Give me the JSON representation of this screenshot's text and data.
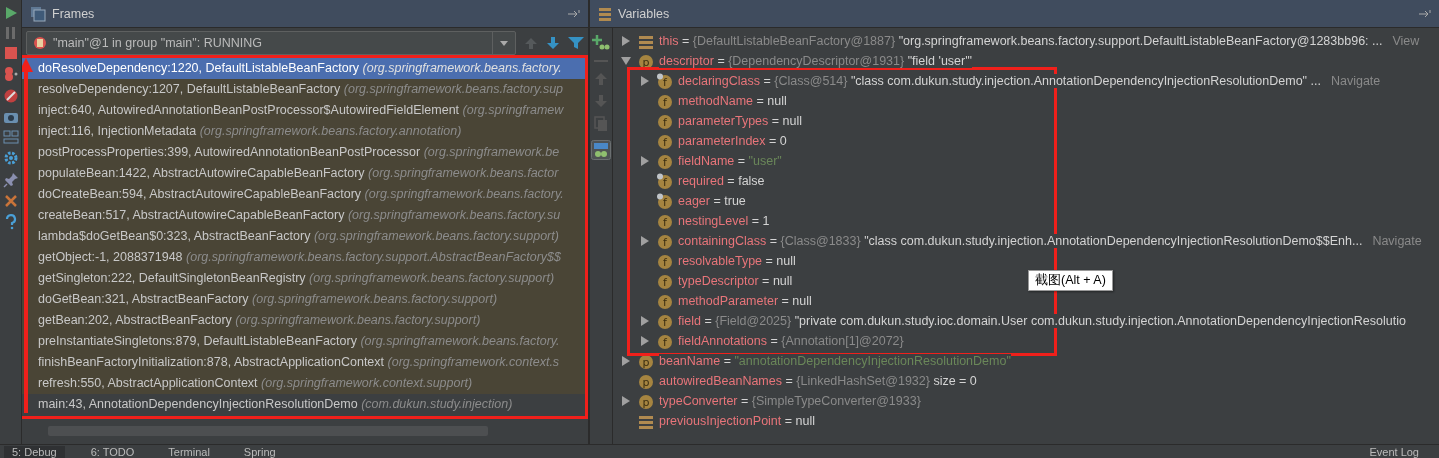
{
  "frames_panel": {
    "title": "Frames",
    "thread": "\"main\"@1 in group \"main\": RUNNING",
    "frames": [
      {
        "location": "doResolveDependency:1220, DefaultListableBeanFactory",
        "package": "(org.springframework.beans.factory.",
        "selected": true,
        "library": true
      },
      {
        "location": "resolveDependency:1207, DefaultListableBeanFactory",
        "package": "(org.springframework.beans.factory.sup",
        "selected": false,
        "library": true
      },
      {
        "location": "inject:640, AutowiredAnnotationBeanPostProcessor$AutowiredFieldElement",
        "package": "(org.springframew",
        "selected": false,
        "library": true
      },
      {
        "location": "inject:116, InjectionMetadata",
        "package": "(org.springframework.beans.factory.annotation)",
        "selected": false,
        "library": true
      },
      {
        "location": "postProcessProperties:399, AutowiredAnnotationBeanPostProcessor",
        "package": "(org.springframework.be",
        "selected": false,
        "library": true
      },
      {
        "location": "populateBean:1422, AbstractAutowireCapableBeanFactory",
        "package": "(org.springframework.beans.factor",
        "selected": false,
        "library": true
      },
      {
        "location": "doCreateBean:594, AbstractAutowireCapableBeanFactory",
        "package": "(org.springframework.beans.factory.",
        "selected": false,
        "library": true
      },
      {
        "location": "createBean:517, AbstractAutowireCapableBeanFactory",
        "package": "(org.springframework.beans.factory.su",
        "selected": false,
        "library": true
      },
      {
        "location": "lambda$doGetBean$0:323, AbstractBeanFactory",
        "package": "(org.springframework.beans.factory.support)",
        "selected": false,
        "library": true
      },
      {
        "location": "getObject:-1, 2088371948",
        "package": "(org.springframework.beans.factory.support.AbstractBeanFactory$$",
        "selected": false,
        "library": true
      },
      {
        "location": "getSingleton:222, DefaultSingletonBeanRegistry",
        "package": "(org.springframework.beans.factory.support)",
        "selected": false,
        "library": true
      },
      {
        "location": "doGetBean:321, AbstractBeanFactory",
        "package": "(org.springframework.beans.factory.support)",
        "selected": false,
        "library": true
      },
      {
        "location": "getBean:202, AbstractBeanFactory",
        "package": "(org.springframework.beans.factory.support)",
        "selected": false,
        "library": true
      },
      {
        "location": "preInstantiateSingletons:879, DefaultListableBeanFactory",
        "package": "(org.springframework.beans.factory.",
        "selected": false,
        "library": true
      },
      {
        "location": "finishBeanFactoryInitialization:878, AbstractApplicationContext",
        "package": "(org.springframework.context.s",
        "selected": false,
        "library": true
      },
      {
        "location": "refresh:550, AbstractApplicationContext",
        "package": "(org.springframework.context.support)",
        "selected": false,
        "library": true
      },
      {
        "location": "main:43, AnnotationDependencyInjectionResolutionDemo",
        "package": "(com.dukun.study.injection)",
        "selected": false,
        "library": false
      }
    ]
  },
  "variables_panel": {
    "title": "Variables",
    "tooltip": "截图(Alt + A)",
    "variables": [
      {
        "kind": "object",
        "sep": "=",
        "name": "this",
        "ref": "{DefaultListableBeanFactory@1887}",
        "value": "\"org.springframework.beans.factory.support.DefaultListableBeanFactory@1283bb96: ...",
        "link": "View",
        "expanded": false
      },
      {
        "kind": "parameter",
        "icon": "p",
        "sep": "=",
        "name": "descriptor",
        "ref": "{DependencyDescriptor@1931}",
        "value": "\"field 'user'\"",
        "expanded": true,
        "children": [
          {
            "kind": "field",
            "icon": "f",
            "sep": "=",
            "final": true,
            "name": "declaringClass",
            "ref": "{Class@514}",
            "value": "\"class com.dukun.study.injection.AnnotationDependencyInjectionResolutionDemo\" ...",
            "link": "Navigate",
            "expanded": false
          },
          {
            "kind": "field",
            "icon": "f",
            "sep": "=",
            "final": false,
            "name": "methodName",
            "value": "null"
          },
          {
            "kind": "field",
            "icon": "f",
            "sep": "=",
            "final": false,
            "name": "parameterTypes",
            "value": "null"
          },
          {
            "kind": "field",
            "icon": "f",
            "sep": "=",
            "final": false,
            "name": "parameterIndex",
            "value": "0"
          },
          {
            "kind": "field",
            "icon": "f",
            "sep": "=",
            "final": false,
            "name": "fieldName",
            "value": "\"user\"",
            "quoted_string": true,
            "expanded": false
          },
          {
            "kind": "field",
            "icon": "f",
            "sep": "=",
            "final": true,
            "name": "required",
            "value": "false"
          },
          {
            "kind": "field",
            "icon": "f",
            "sep": "=",
            "final": true,
            "name": "eager",
            "value": "true"
          },
          {
            "kind": "field",
            "icon": "f",
            "sep": "=",
            "final": false,
            "name": "nestingLevel",
            "value": "1"
          },
          {
            "kind": "field",
            "icon": "f",
            "sep": "=",
            "final": false,
            "name": "containingClass",
            "ref": "{Class@1833}",
            "value": "\"class com.dukun.study.injection.AnnotationDependencyInjectionResolutionDemo$$Enh...",
            "link": "Navigate",
            "expanded": false
          },
          {
            "kind": "field",
            "icon": "f",
            "sep": "=",
            "final": false,
            "name": "resolvableType",
            "value": "null"
          },
          {
            "kind": "field",
            "icon": "f",
            "sep": "=",
            "final": false,
            "name": "typeDescriptor",
            "value": "null"
          },
          {
            "kind": "field",
            "icon": "f",
            "sep": "=",
            "final": false,
            "name": "methodParameter",
            "value": "null"
          },
          {
            "kind": "field",
            "icon": "f",
            "sep": "=",
            "final": false,
            "name": "field",
            "ref": "{Field@2025}",
            "value": "\"private com.dukun.study.ioc.domain.User com.dukun.study.injection.AnnotationDependencyInjectionResolutio",
            "expanded": false
          },
          {
            "kind": "field",
            "icon": "f",
            "sep": "=",
            "final": false,
            "name": "fieldAnnotations",
            "ref": "{Annotation[1]@2072}",
            "expanded": false
          }
        ]
      },
      {
        "kind": "parameter",
        "icon": "p",
        "sep": "=",
        "name": "beanName",
        "value": "\"annotationDependencyInjectionResolutionDemo\"",
        "quoted_string": true,
        "expanded": false
      },
      {
        "kind": "parameter",
        "icon": "p",
        "sep": "=",
        "name": "autowiredBeanNames",
        "ref": "{LinkedHashSet@1932}",
        "value": "size = 0"
      },
      {
        "kind": "parameter",
        "icon": "p",
        "sep": "=",
        "name": "typeConverter",
        "ref": "{SimpleTypeConverter@1933}",
        "expanded": false
      },
      {
        "kind": "object",
        "sep": "=",
        "name": "previousInjectionPoint",
        "value": "null"
      }
    ]
  },
  "bottom_tabs": [
    {
      "label": "5: Debug",
      "selected": true
    },
    {
      "label": "6: TODO",
      "selected": false
    },
    {
      "label": "Terminal",
      "selected": false
    },
    {
      "label": "Spring",
      "selected": false
    }
  ],
  "event_log": "Event Log"
}
